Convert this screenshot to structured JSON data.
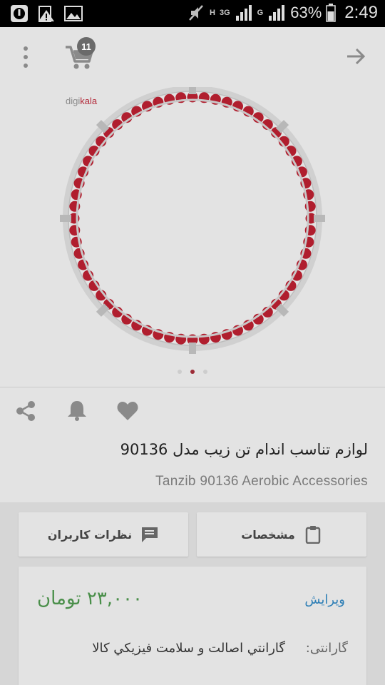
{
  "status_bar": {
    "net_h": "H",
    "net_3g": "3G",
    "net_g": "G",
    "battery_percent": "63%",
    "time": "2:49",
    "icons": [
      "notification-icon",
      "warning-icon",
      "gallery-icon",
      "mute-icon",
      "signal-icon",
      "battery-icon"
    ]
  },
  "header": {
    "cart_count": "11",
    "icons": [
      "more-vert-icon",
      "cart-icon",
      "arrow-forward-icon"
    ]
  },
  "gallery": {
    "brand": {
      "prefix": "digi",
      "accent": "kala"
    },
    "page_count": 3,
    "active_page": 2,
    "accent_color": "#9c2b36"
  },
  "actions": {
    "icons": [
      "share-icon",
      "bell-icon",
      "heart-icon"
    ]
  },
  "product": {
    "title_fa": "لوازم تناسب اندام تن زیب مدل 90136",
    "title_en": "Tanzib 90136 Aerobic Accessories"
  },
  "tabs": {
    "reviews_label": "نظرات کاربران",
    "specs_label": "مشخصات"
  },
  "price_card": {
    "price": "۲۳,۰۰۰ تومان",
    "edit_label": "ویرایش",
    "warranty_label": "گارانتی:",
    "warranty_value": "گارانتي اصالت و سلامت فيزيکي کالا"
  },
  "colors": {
    "price_green": "#4a8f4a",
    "link_blue": "#2f7fb6",
    "hoop_red": "#b01e2e"
  }
}
